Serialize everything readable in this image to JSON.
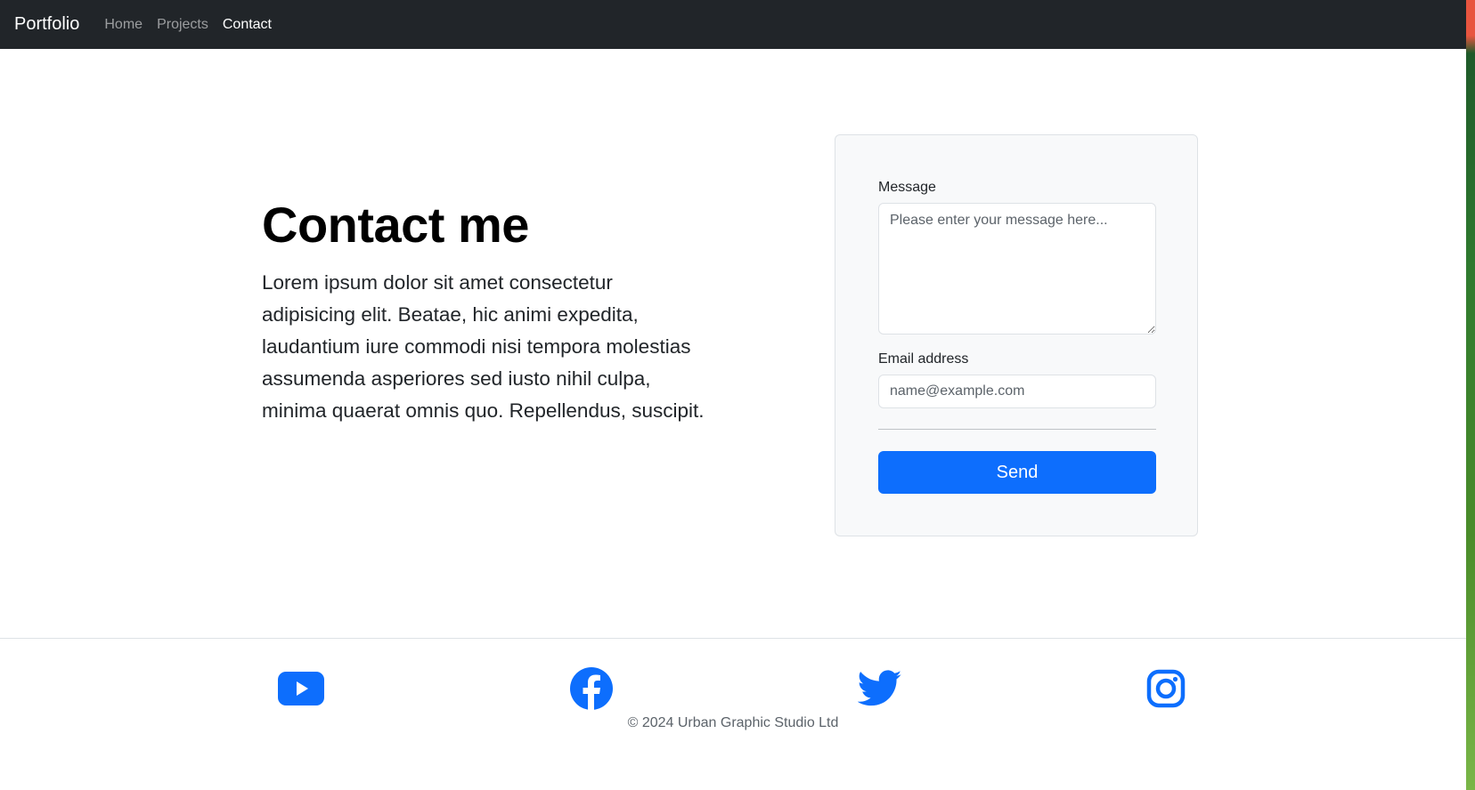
{
  "navbar": {
    "brand": "Portfolio",
    "links": [
      "Home",
      "Projects",
      "Contact"
    ],
    "active": "Contact"
  },
  "hero": {
    "title": "Contact me",
    "text": "Lorem ipsum dolor sit amet consectetur adipisicing elit. Beatae, hic animi expedita, laudantium iure commodi nisi tempora molestias assumenda asperiores sed iusto nihil culpa, minima quaerat omnis quo. Repellendus, suscipit."
  },
  "form": {
    "message_label": "Message",
    "message_placeholder": "Please enter your message here...",
    "message_value": "",
    "email_label": "Email address",
    "email_placeholder": "name@example.com",
    "email_value": "",
    "send_label": "Send"
  },
  "footer": {
    "social_icons": [
      "youtube-icon",
      "facebook-icon",
      "twitter-icon",
      "instagram-icon"
    ],
    "copyright": "© 2024 Urban Graphic Studio Ltd"
  },
  "colors": {
    "navbar_bg": "#212529",
    "accent": "#0d6efd",
    "card_bg": "#f8f9fa"
  }
}
